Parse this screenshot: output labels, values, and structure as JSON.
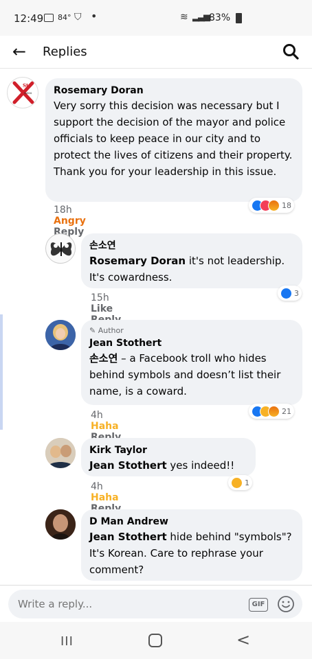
{
  "status_bar": {
    "time": "12:49",
    "temperature": "84°",
    "battery_percent": "83%"
  },
  "header": {
    "back_icon": "arrow-left",
    "title": "Replies",
    "search_icon": "magnifier"
  },
  "comments": [
    {
      "author": "Rosemary Doran",
      "text": "Very sorry this decision was necessary but I support the decision of the mayor and police officials to keep peace in our city and to protect the lives of citizens and their property. Thank you  for your leadership in this issue.",
      "time": "18h",
      "reaction_label": "Angry",
      "reply_label": "Reply",
      "reaction_count": "18"
    },
    {
      "author": "손소연",
      "mention": "Rosemary Doran",
      "text": " it's not leadership. It's cowardness.",
      "time": "15h",
      "reaction_label": "Like",
      "reply_label": "Reply",
      "reaction_count": "3"
    },
    {
      "badge": "Author",
      "author": "Jean Stothert",
      "mention": "손소연",
      "text": " – a Facebook troll who hides behind symbols and doesn’t list their name, is a coward.",
      "time": "4h",
      "reaction_label": "Haha",
      "reply_label": "Reply",
      "reaction_count": "21"
    },
    {
      "author": "Kirk Taylor",
      "mention": "Jean Stothert",
      "text": " yes indeed!!",
      "time": "4h",
      "reaction_label": "Haha",
      "reply_label": "Reply",
      "reaction_count": "1"
    },
    {
      "author": "D Man Andrew",
      "mention": "Jean Stothert",
      "text": " hide behind \"symbols\"?  It's Korean.  Care to rephrase your comment?"
    }
  ],
  "reply_bar": {
    "placeholder": "Write a reply...",
    "gif_label": "GIF"
  },
  "nav": {
    "recent_label": "III",
    "back_label": "<"
  },
  "colors": {
    "bubble": "#f0f2f5",
    "angry": "#e9710f",
    "haha": "#f7b125",
    "like": "#1877f2"
  }
}
